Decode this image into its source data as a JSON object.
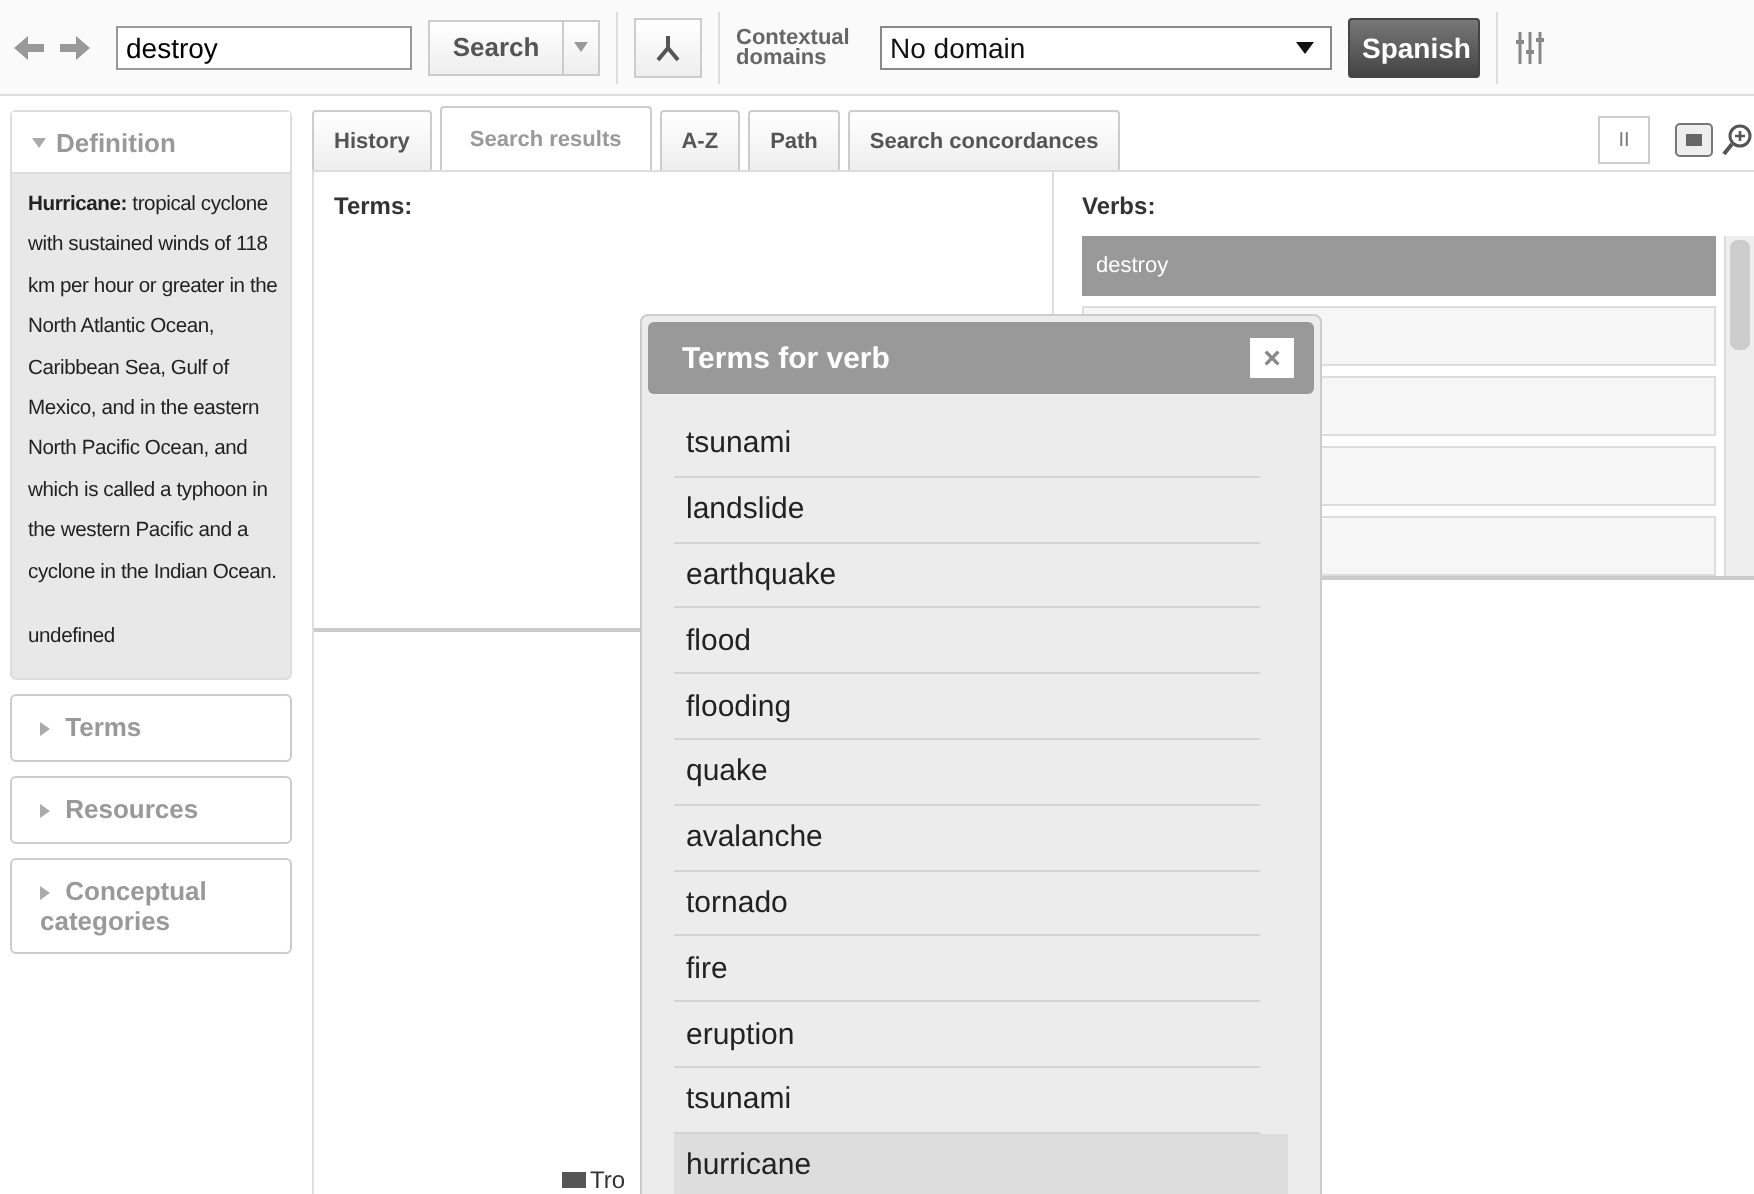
{
  "toolbar": {
    "search_value": "destroy",
    "search_button": "Search",
    "domains_label": "Contextual domains",
    "domain_select": "No domain",
    "language_button": "Spanish"
  },
  "sidebar": {
    "definition": {
      "title": "Definition",
      "expanded": true,
      "text": "**Hurricane:** tropical cyclone with sustained winds of 118 km per hour or greater in the North Atlantic Ocean, Caribbean Sea, Gulf of Mexico, and in the eastern North Pacific Ocean, and which is called a typhoon in the western Pacific and a cyclone in the Indian Ocean.",
      "note": "undefined"
    },
    "sections": [
      {
        "title": "Terms",
        "expanded": false
      },
      {
        "title": "Resources",
        "expanded": false
      },
      {
        "title": "Conceptual categories",
        "expanded": false
      }
    ]
  },
  "tabs": [
    {
      "label": "History",
      "selected": false
    },
    {
      "label": "Search results",
      "selected": true
    },
    {
      "label": "A-Z",
      "selected": false
    },
    {
      "label": "Path",
      "selected": false
    },
    {
      "label": "Search concordances",
      "selected": false
    }
  ],
  "pause_button": "II",
  "terms_heading": "Terms:",
  "verbs_heading": "Verbs:",
  "verbs": [
    {
      "label": "destroy",
      "selected": true
    }
  ],
  "legend_text": "Tro",
  "dialog": {
    "title": "Terms for verb",
    "close": "×",
    "items": [
      {
        "label": "tsunami",
        "selected": false
      },
      {
        "label": "landslide",
        "selected": false
      },
      {
        "label": "earthquake",
        "selected": false
      },
      {
        "label": "flood",
        "selected": false
      },
      {
        "label": "flooding",
        "selected": false
      },
      {
        "label": "quake",
        "selected": false
      },
      {
        "label": "avalanche",
        "selected": false
      },
      {
        "label": "tornado",
        "selected": false
      },
      {
        "label": "fire",
        "selected": false
      },
      {
        "label": "eruption",
        "selected": false
      },
      {
        "label": "tsunami",
        "selected": false
      },
      {
        "label": "hurricane",
        "selected": true
      }
    ]
  }
}
